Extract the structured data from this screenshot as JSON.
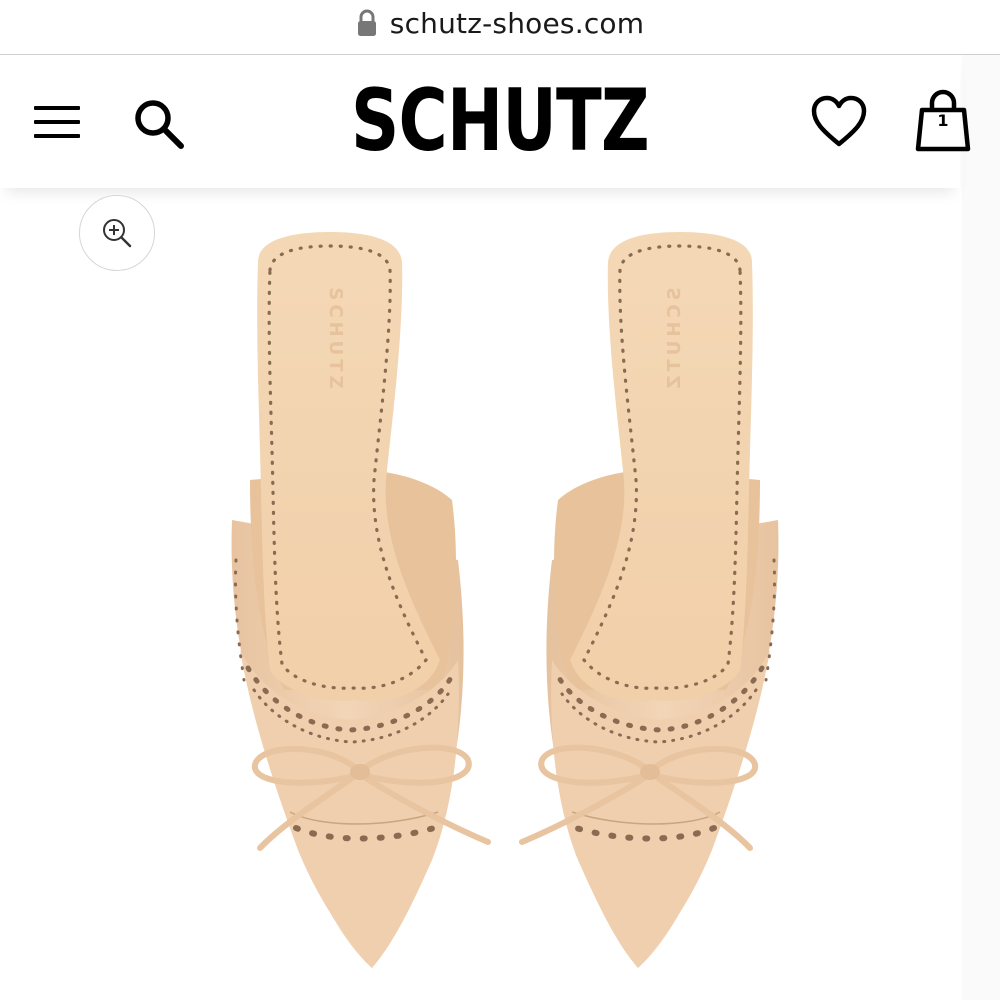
{
  "browser": {
    "url": "schutz-shoes.com",
    "lock_icon": "lock-icon"
  },
  "header": {
    "brand": "SCHUTZ",
    "menu_icon": "hamburger-menu-icon",
    "search_icon": "search-icon",
    "wishlist_icon": "heart-icon",
    "bag_icon": "shopping-bag-icon",
    "bag_count": "1"
  },
  "product": {
    "zoom_icon": "zoom-in-icon",
    "insole_brand": "SCHUTZ",
    "colors": {
      "leather": "#efcfaf",
      "insole": "#f3d6b4",
      "lining": "#e9c49e",
      "perforation": "#8a6a50"
    }
  }
}
